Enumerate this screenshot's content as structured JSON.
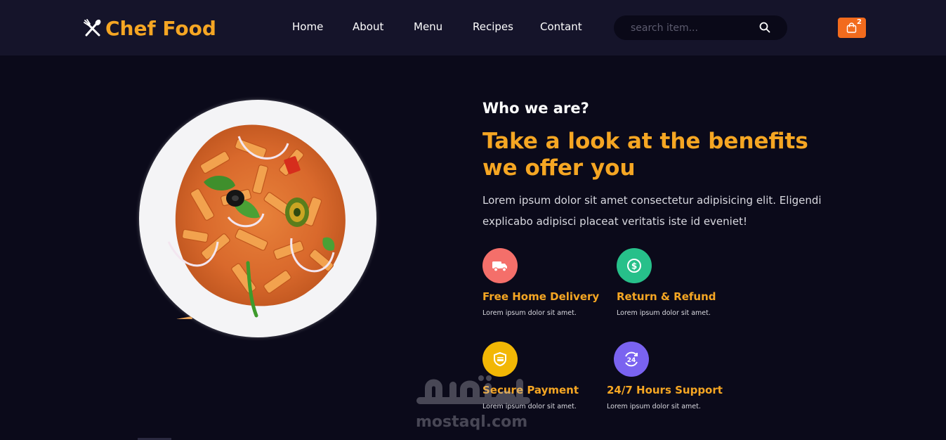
{
  "brand": {
    "name": "Chef Food",
    "icon": "fork-knife-icon",
    "color": "#f5a623"
  },
  "nav": {
    "items": [
      "Home",
      "About",
      "Menu",
      "Recipes",
      "Contant"
    ]
  },
  "search": {
    "placeholder": "search item...",
    "value": "",
    "icon": "search-icon"
  },
  "cart": {
    "count": "2",
    "icon": "shopping-bag-icon",
    "color": "#f26b1d"
  },
  "hero": {
    "image": "pasta-plate",
    "eyebrow": "Who we are?",
    "headline": "Take a look at the benefits we offer you",
    "description": "Lorem ipsum dolor sit amet consectetur adipisicing elit. Eligendi explicabo adipisci placeat veritatis iste id eveniet!"
  },
  "features": [
    {
      "title": "Free Home Delivery",
      "text": "Lorem ipsum dolor sit amet.",
      "icon": "truck-icon",
      "color": "#f46f6a"
    },
    {
      "title": "Return & Refund",
      "text": "Lorem ipsum dolor sit amet.",
      "icon": "dollar-coin-icon",
      "color": "#27c08a"
    },
    {
      "title": "Secure Payment",
      "text": "Lorem ipsum dolor sit amet.",
      "icon": "card-shield-icon",
      "color": "#f2b705"
    },
    {
      "title": "24/7 Hours Support",
      "text": "Lorem ipsum dolor sit amet.",
      "icon": "support-24-icon",
      "color": "#7a63f0"
    }
  ],
  "watermark": {
    "arabic": "مستقل",
    "latin": "mostaql.com"
  }
}
